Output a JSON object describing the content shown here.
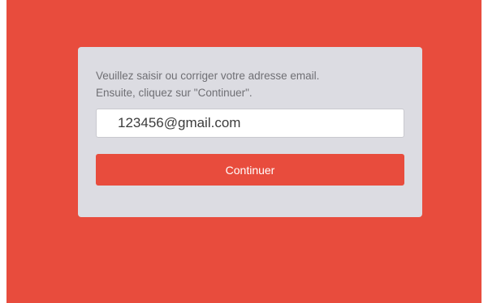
{
  "form": {
    "instructions_line1": "Veuillez saisir ou corriger votre adresse email.",
    "instructions_line2": "Ensuite, cliquez sur \"Continuer\".",
    "email_value": "123456@gmail.com",
    "continue_label": "Continuer"
  },
  "colors": {
    "background": "#e84c3d",
    "card": "#dcdce2",
    "button": "#e84c3d",
    "button_text": "#ffffff"
  }
}
